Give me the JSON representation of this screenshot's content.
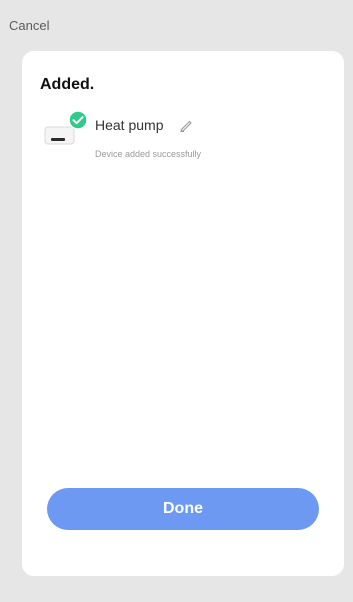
{
  "header": {
    "cancel_label": "Cancel"
  },
  "card": {
    "title": "Added.",
    "device": {
      "name": "Heat pump",
      "status": "Device added successfully",
      "icon": "heat-pump-device-icon",
      "badge_icon": "check-circle-icon",
      "edit_icon": "pencil-icon"
    },
    "done_label": "Done"
  },
  "colors": {
    "background": "#e6e6e6",
    "card": "#ffffff",
    "accent": "#6d99f2",
    "success": "#2ecb8a"
  }
}
